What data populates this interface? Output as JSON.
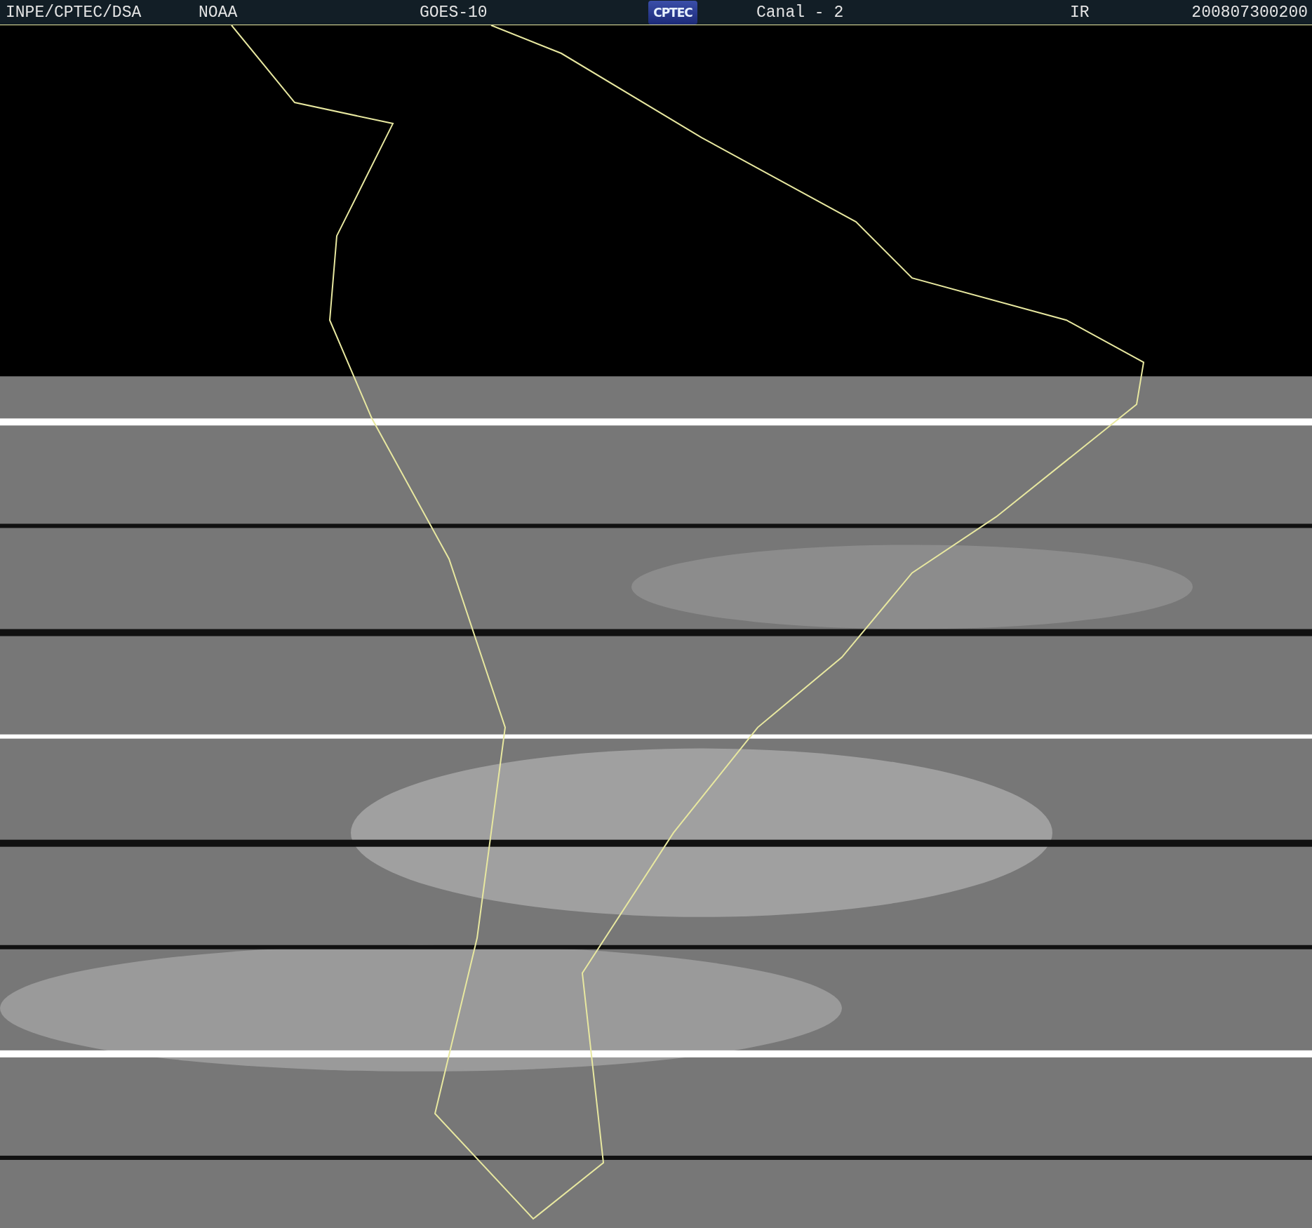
{
  "header": {
    "items": [
      {
        "text": "INPE/CPTEC/DSA"
      },
      {
        "text": "NOAA"
      },
      {
        "text": "GOES-10"
      },
      {
        "text": "Canal - 2"
      },
      {
        "text": "IR"
      },
      {
        "text": "200807300200"
      }
    ],
    "logo": {
      "text": "CPTEC"
    }
  }
}
